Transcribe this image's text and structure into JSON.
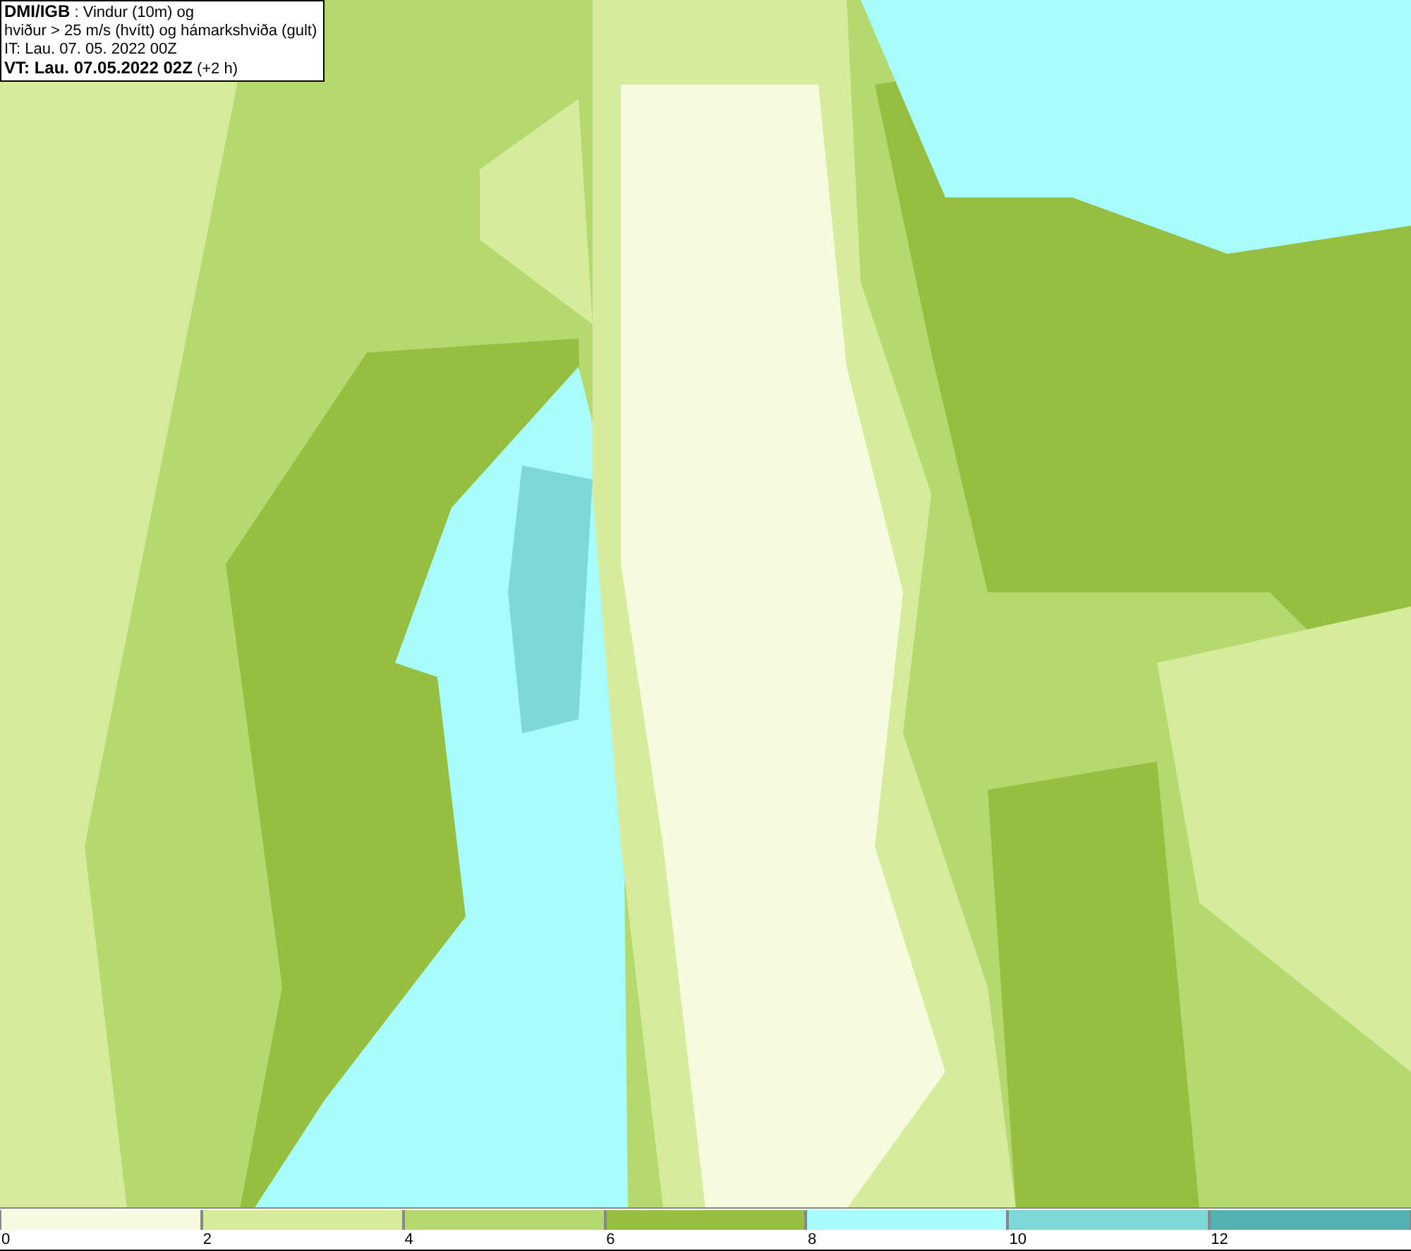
{
  "title_box": {
    "lines": [
      "**DMI/IGB** : Vindur (10m) og",
      "hviður > 25 m/s (hvítt) og hámarkshviða (gult)",
      "IT: Lau. 07. 05. 2022 00Z",
      "**VT: Lau. 07.05.2022 02Z** (+2 h)"
    ]
  },
  "legend": {
    "bins": [
      {
        "color": "#f5fbdc"
      },
      {
        "color": "#d4ec9c"
      },
      {
        "color": "#b5d96e"
      },
      {
        "color": "#96bf42"
      },
      {
        "color": "#a8fcfc"
      },
      {
        "color": "#7fd8d8"
      },
      {
        "color": "#55b2b2"
      }
    ],
    "ticks": [
      "0",
      "2",
      "4",
      "6",
      "8",
      "10",
      "12"
    ]
  }
}
